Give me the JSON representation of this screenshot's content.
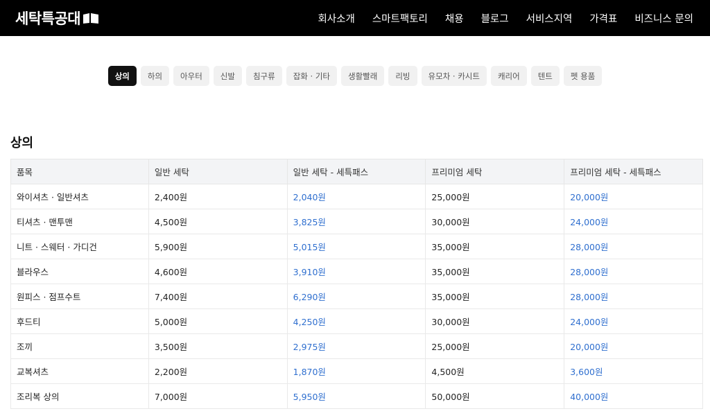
{
  "brand": {
    "name": "세탁특공대"
  },
  "nav": [
    "회사소개",
    "스마트팩토리",
    "채용",
    "블로그",
    "서비스지역",
    "가격표",
    "비즈니스 문의"
  ],
  "tabs": [
    {
      "label": "상의",
      "active": true
    },
    {
      "label": "하의"
    },
    {
      "label": "아우터"
    },
    {
      "label": "신발"
    },
    {
      "label": "침구류"
    },
    {
      "label": "잡화 · 기타"
    },
    {
      "label": "생활빨래"
    },
    {
      "label": "리빙"
    },
    {
      "label": "유모차 · 카시트"
    },
    {
      "label": "캐리어"
    },
    {
      "label": "텐트"
    },
    {
      "label": "펫 용품"
    }
  ],
  "section": {
    "title": "상의",
    "headers": [
      "품목",
      "일반 세탁",
      "일반 세탁 - 세특패스",
      "프리미엄 세탁",
      "프리미엄 세탁 - 세특패스"
    ],
    "rows": [
      [
        "와이셔츠 · 일반셔츠",
        "2,400원",
        "2,040원",
        "25,000원",
        "20,000원"
      ],
      [
        "티셔츠 · 맨투맨",
        "4,500원",
        "3,825원",
        "30,000원",
        "24,000원"
      ],
      [
        "니트 · 스웨터 · 가디건",
        "5,900원",
        "5,015원",
        "35,000원",
        "28,000원"
      ],
      [
        "블라우스",
        "4,600원",
        "3,910원",
        "35,000원",
        "28,000원"
      ],
      [
        "원피스 · 점프수트",
        "7,400원",
        "6,290원",
        "35,000원",
        "28,000원"
      ],
      [
        "후드티",
        "5,000원",
        "4,250원",
        "30,000원",
        "24,000원"
      ],
      [
        "조끼",
        "3,500원",
        "2,975원",
        "25,000원",
        "20,000원"
      ],
      [
        "교복셔츠",
        "2,200원",
        "1,870원",
        "4,500원",
        "3,600원"
      ],
      [
        "조리복 상의",
        "7,000원",
        "5,950원",
        "50,000원",
        "40,000원"
      ]
    ]
  },
  "colors": {
    "header_bg": "#000000",
    "active_tab": "#111111",
    "pass_price": "#2f6fcf"
  }
}
